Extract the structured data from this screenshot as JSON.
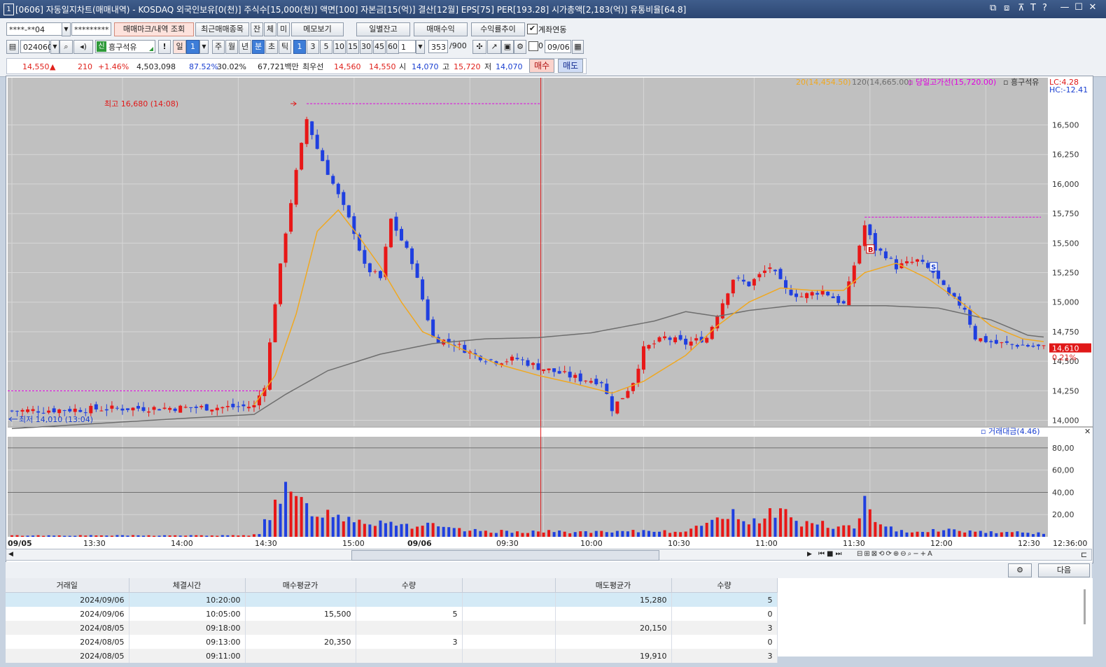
{
  "window": {
    "number": "1",
    "title": "[0606] 자동일지차트(매매내역) - KOSDAQ 외국인보유[0(천)] 주식수[15,000(천)] 액면[100] 자본금[15(억)] 결산[12월] EPS[75] PER[193.28] 시가총액[2,183(억)] 유통비율[64.8]",
    "icons": [
      "restore-icon",
      "tile-icon",
      "pin-icon",
      "font-icon",
      "help-icon",
      "minimize-icon",
      "maximize-icon",
      "close-icon"
    ],
    "icon_glyphs": [
      "⧉",
      "⧈",
      "⊼",
      "T",
      "?",
      "—",
      "☐",
      "✕"
    ]
  },
  "toolbar1": {
    "account": "****-**04",
    "password": "*********",
    "trade_mark_btn": "매매마크/내역 조회",
    "recent_btn": "최근매매종목",
    "small1": "잔",
    "small2": "체",
    "small3": "미",
    "memo_btn": "메모보기",
    "daily_btn": "일별잔고",
    "profit_btn": "매매수익",
    "rate_btn": "수익률추이",
    "link_label": "계좌연동",
    "link_checked": true
  },
  "toolbar2": {
    "code": "024060",
    "badge": "신",
    "stock_name": "흥구석유",
    "excl": "!",
    "period": "일",
    "period_n": "1",
    "period_buttons": [
      "주",
      "월",
      "년",
      "분",
      "초",
      "틱"
    ],
    "selected_period": "분",
    "interval_buttons": [
      "1",
      "3",
      "5",
      "10",
      "15",
      "30",
      "45",
      "60"
    ],
    "selected_interval": "1",
    "count_value": "1",
    "data_count": "353",
    "data_max": "/900",
    "zero_label": "0",
    "date_value": "09/06"
  },
  "quote": {
    "price": "14,550",
    "arrow": "▲",
    "change": "210",
    "change_pct": "+1.46%",
    "volume": "4,503,098",
    "vol_ratio": "87.52%",
    "turnover": "30.02%",
    "amount": "67,721백만",
    "best_label": "최우선",
    "best_ask": "14,560",
    "best_bid": "14,550",
    "open_label": "시",
    "open": "14,070",
    "high_label": "고",
    "high": "15,720",
    "low_label": "저",
    "low": "14,070",
    "buy_btn": "매수",
    "sell_btn": "매도"
  },
  "chart_data": {
    "type": "candlestick",
    "legend": {
      "ma20": "20(14,454.50)",
      "ma120": "120(14,665.00)",
      "high_line": "당일고가선(15,720.00)",
      "symbol": "흥구석유",
      "lc": "LC:4.28",
      "hc": "HC:-12.41"
    },
    "colors": {
      "up": "#e81717",
      "down": "#1f3fe0",
      "ma20": "#f0a820",
      "ma120": "#6e6e6e",
      "high_line": "#e000e0",
      "bg": "#c0c0c0"
    },
    "price_ticks": [
      "16,500",
      "16,250",
      "16,000",
      "15,750",
      "15,500",
      "15,250",
      "15,000",
      "14,750",
      "14,500",
      "14,250",
      "14,000"
    ],
    "price_tick_values": [
      16500,
      16250,
      16000,
      15750,
      15500,
      15250,
      15000,
      14750,
      14500,
      14250,
      14000
    ],
    "price_range": [
      13950,
      16900
    ],
    "current_price_tag": "14,610",
    "current_pct_tag": "0.21%",
    "annotations": {
      "high": "최고 16,680 (14:08)",
      "low": "최저 14,010 (13:04)",
      "buy_mark": "B",
      "sell_mark": "S"
    },
    "volume_label": "거래대금(4.46)",
    "volume_ticks": [
      "80,00",
      "60,00",
      "40,00",
      "20,00"
    ],
    "volume_tick_values": [
      80,
      60,
      40,
      20
    ],
    "volume_range": [
      0,
      90
    ],
    "time_labels": [
      "09/05",
      "13:30",
      "14:00",
      "14:30",
      "15:00",
      "09/06",
      "09:30",
      "10:00",
      "10:30",
      "11:00",
      "11:30",
      "12:00",
      "12:30",
      "12:36:00"
    ],
    "bars": 197,
    "close_anchors": [
      [
        0,
        14080
      ],
      [
        20,
        14100
      ],
      [
        40,
        14110
      ],
      [
        46,
        14120
      ],
      [
        48,
        14300
      ],
      [
        50,
        15000
      ],
      [
        52,
        15600
      ],
      [
        54,
        16100
      ],
      [
        56,
        16550
      ],
      [
        58,
        16300
      ],
      [
        62,
        15900
      ],
      [
        65,
        15600
      ],
      [
        67,
        15300
      ],
      [
        70,
        15200
      ],
      [
        72,
        15700
      ],
      [
        76,
        15350
      ],
      [
        80,
        14700
      ],
      [
        84,
        14650
      ],
      [
        88,
        14550
      ],
      [
        92,
        14500
      ],
      [
        96,
        14520
      ],
      [
        100,
        14450
      ],
      [
        104,
        14400
      ],
      [
        108,
        14350
      ],
      [
        112,
        14330
      ],
      [
        114,
        14100
      ],
      [
        116,
        14200
      ],
      [
        118,
        14330
      ],
      [
        120,
        14600
      ],
      [
        124,
        14700
      ],
      [
        128,
        14650
      ],
      [
        132,
        14700
      ],
      [
        134,
        14900
      ],
      [
        137,
        15200
      ],
      [
        140,
        15150
      ],
      [
        144,
        15300
      ],
      [
        147,
        15100
      ],
      [
        150,
        15050
      ],
      [
        154,
        15100
      ],
      [
        158,
        14980
      ],
      [
        162,
        15650
      ],
      [
        164,
        15450
      ],
      [
        166,
        15400
      ],
      [
        168,
        15300
      ],
      [
        172,
        15350
      ],
      [
        175,
        15250
      ],
      [
        178,
        15050
      ],
      [
        181,
        14950
      ],
      [
        183,
        14700
      ],
      [
        187,
        14650
      ],
      [
        191,
        14640
      ],
      [
        197,
        14610
      ]
    ],
    "ma20_anchors": [
      [
        46,
        14130
      ],
      [
        50,
        14380
      ],
      [
        54,
        14900
      ],
      [
        58,
        15600
      ],
      [
        62,
        15780
      ],
      [
        66,
        15550
      ],
      [
        70,
        15300
      ],
      [
        74,
        15000
      ],
      [
        78,
        14750
      ],
      [
        84,
        14630
      ],
      [
        92,
        14480
      ],
      [
        100,
        14380
      ],
      [
        106,
        14320
      ],
      [
        114,
        14230
      ],
      [
        120,
        14330
      ],
      [
        128,
        14550
      ],
      [
        134,
        14800
      ],
      [
        140,
        15000
      ],
      [
        146,
        15120
      ],
      [
        152,
        15100
      ],
      [
        158,
        15100
      ],
      [
        162,
        15250
      ],
      [
        168,
        15330
      ],
      [
        174,
        15200
      ],
      [
        180,
        15010
      ],
      [
        186,
        14800
      ],
      [
        192,
        14690
      ],
      [
        197,
        14660
      ]
    ],
    "ma120_anchors": [
      [
        0,
        13930
      ],
      [
        30,
        14010
      ],
      [
        46,
        14050
      ],
      [
        52,
        14220
      ],
      [
        60,
        14420
      ],
      [
        70,
        14560
      ],
      [
        80,
        14650
      ],
      [
        90,
        14690
      ],
      [
        100,
        14700
      ],
      [
        110,
        14740
      ],
      [
        122,
        14840
      ],
      [
        128,
        14920
      ],
      [
        134,
        14880
      ],
      [
        140,
        14930
      ],
      [
        148,
        14970
      ],
      [
        156,
        14970
      ],
      [
        166,
        14970
      ],
      [
        176,
        14950
      ],
      [
        186,
        14850
      ],
      [
        193,
        14720
      ],
      [
        197,
        14700
      ]
    ],
    "volume_spikes": [
      [
        48,
        18
      ],
      [
        50,
        32
      ],
      [
        52,
        49
      ],
      [
        54,
        40
      ],
      [
        56,
        34
      ],
      [
        58,
        28
      ],
      [
        60,
        26
      ],
      [
        62,
        24
      ],
      [
        64,
        22
      ],
      [
        66,
        20
      ],
      [
        68,
        16
      ],
      [
        70,
        17
      ],
      [
        72,
        18
      ],
      [
        74,
        14
      ],
      [
        76,
        12
      ],
      [
        78,
        14
      ],
      [
        80,
        12
      ],
      [
        84,
        8
      ],
      [
        90,
        6
      ],
      [
        100,
        6
      ],
      [
        114,
        5
      ],
      [
        118,
        6
      ],
      [
        122,
        7
      ],
      [
        126,
        6
      ],
      [
        132,
        12
      ],
      [
        134,
        27
      ],
      [
        136,
        26
      ],
      [
        138,
        24
      ],
      [
        140,
        18
      ],
      [
        142,
        20
      ],
      [
        144,
        28
      ],
      [
        146,
        30
      ],
      [
        148,
        22
      ],
      [
        150,
        14
      ],
      [
        152,
        18
      ],
      [
        156,
        10
      ],
      [
        160,
        12
      ],
      [
        162,
        40
      ],
      [
        164,
        14
      ],
      [
        166,
        10
      ],
      [
        168,
        8
      ],
      [
        172,
        6
      ],
      [
        176,
        8
      ],
      [
        184,
        6
      ],
      [
        196,
        4
      ]
    ]
  },
  "bottom_scroll": {
    "next_btn": "다음"
  },
  "trade_table": {
    "headers": [
      "거래일",
      "체결시간",
      "매수평균가",
      "수량",
      "",
      "매도평균가",
      "수량"
    ],
    "rows": [
      [
        "2024/09/06",
        "10:20:00",
        "",
        "",
        "",
        "15,280",
        "5"
      ],
      [
        "2024/09/06",
        "10:05:00",
        "15,500",
        "5",
        "",
        "",
        "0"
      ],
      [
        "2024/08/05",
        "09:18:00",
        "",
        "",
        "",
        "20,150",
        "3"
      ],
      [
        "2024/08/05",
        "09:13:00",
        "20,350",
        "3",
        "",
        "",
        "0"
      ],
      [
        "2024/08/05",
        "09:11:00",
        "",
        "",
        "",
        "19,910",
        "3"
      ]
    ]
  }
}
